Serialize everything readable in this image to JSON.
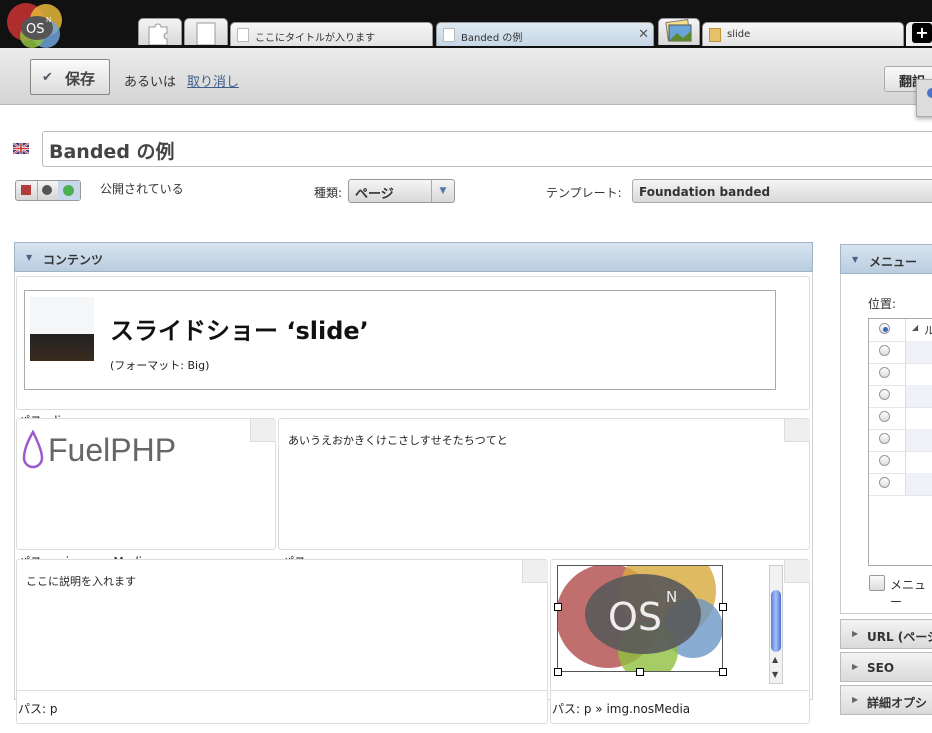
{
  "app": {
    "logo_text": "OS",
    "logo_sup": "N"
  },
  "tabs": [
    {
      "label": "ここにタイトルが入ります",
      "active": false
    },
    {
      "label": "Banded の例",
      "active": true
    },
    {
      "label": "slide",
      "active": false
    }
  ],
  "tab_icons": [
    "puzzle-icon",
    "blank-page-icon",
    "gallery-icon"
  ],
  "new_tab_label": "+",
  "toolbar": {
    "save_label": "保存",
    "or_label": "あるいは",
    "cancel_label": "取り消し",
    "translate_label": "翻訳"
  },
  "page": {
    "title_value": "Banded の例",
    "status_label": "公開されている",
    "type_label": "種類:",
    "type_value": "ページ",
    "template_label": "テンプレート:",
    "template_value": "Foundation banded"
  },
  "content": {
    "header": "コンテンツ",
    "slideshow_title": "スライドショー ‘slide’",
    "slideshow_format": "(フォーマット: Big)",
    "blocks": [
      {
        "path": "パス: div"
      },
      {
        "path": "パス: … img.nosMedia",
        "image": "FuelPHP"
      },
      {
        "path": "パス: p",
        "text": "あいうえおかきくけこさしすせそたちつてと"
      },
      {
        "path": "パス: p",
        "text": "ここに説明を入れます"
      },
      {
        "path": "パス: p » img.nosMedia",
        "image": "OS"
      }
    ]
  },
  "menu": {
    "header": "メニュー",
    "position_label": "位置:",
    "tree_col": "ル",
    "checkbox_label": "メニュー"
  },
  "side_sections": [
    {
      "label": "URL (ページ"
    },
    {
      "label": "SEO"
    },
    {
      "label": "詳細オプシ"
    }
  ],
  "colors": {
    "accent_blue": "#3a66c4",
    "header_blue": "#c6d6e6",
    "published_green": "#4caf50",
    "unpublished_red": "#b23a3a"
  }
}
